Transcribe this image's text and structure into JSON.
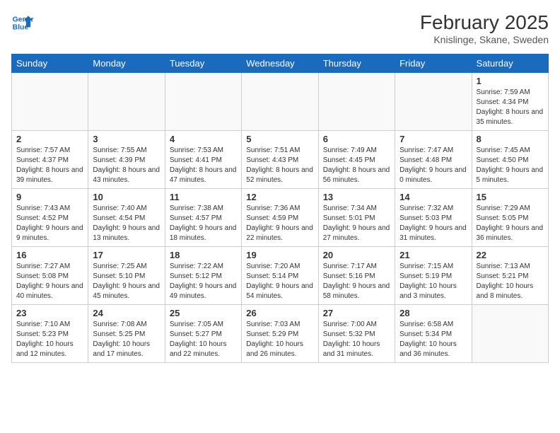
{
  "header": {
    "logo_line1": "General",
    "logo_line2": "Blue",
    "month_year": "February 2025",
    "location": "Knislinge, Skane, Sweden"
  },
  "days_of_week": [
    "Sunday",
    "Monday",
    "Tuesday",
    "Wednesday",
    "Thursday",
    "Friday",
    "Saturday"
  ],
  "weeks": [
    [
      {
        "day": "",
        "info": ""
      },
      {
        "day": "",
        "info": ""
      },
      {
        "day": "",
        "info": ""
      },
      {
        "day": "",
        "info": ""
      },
      {
        "day": "",
        "info": ""
      },
      {
        "day": "",
        "info": ""
      },
      {
        "day": "1",
        "info": "Sunrise: 7:59 AM\nSunset: 4:34 PM\nDaylight: 8 hours and 35 minutes."
      }
    ],
    [
      {
        "day": "2",
        "info": "Sunrise: 7:57 AM\nSunset: 4:37 PM\nDaylight: 8 hours and 39 minutes."
      },
      {
        "day": "3",
        "info": "Sunrise: 7:55 AM\nSunset: 4:39 PM\nDaylight: 8 hours and 43 minutes."
      },
      {
        "day": "4",
        "info": "Sunrise: 7:53 AM\nSunset: 4:41 PM\nDaylight: 8 hours and 47 minutes."
      },
      {
        "day": "5",
        "info": "Sunrise: 7:51 AM\nSunset: 4:43 PM\nDaylight: 8 hours and 52 minutes."
      },
      {
        "day": "6",
        "info": "Sunrise: 7:49 AM\nSunset: 4:45 PM\nDaylight: 8 hours and 56 minutes."
      },
      {
        "day": "7",
        "info": "Sunrise: 7:47 AM\nSunset: 4:48 PM\nDaylight: 9 hours and 0 minutes."
      },
      {
        "day": "8",
        "info": "Sunrise: 7:45 AM\nSunset: 4:50 PM\nDaylight: 9 hours and 5 minutes."
      }
    ],
    [
      {
        "day": "9",
        "info": "Sunrise: 7:43 AM\nSunset: 4:52 PM\nDaylight: 9 hours and 9 minutes."
      },
      {
        "day": "10",
        "info": "Sunrise: 7:40 AM\nSunset: 4:54 PM\nDaylight: 9 hours and 13 minutes."
      },
      {
        "day": "11",
        "info": "Sunrise: 7:38 AM\nSunset: 4:57 PM\nDaylight: 9 hours and 18 minutes."
      },
      {
        "day": "12",
        "info": "Sunrise: 7:36 AM\nSunset: 4:59 PM\nDaylight: 9 hours and 22 minutes."
      },
      {
        "day": "13",
        "info": "Sunrise: 7:34 AM\nSunset: 5:01 PM\nDaylight: 9 hours and 27 minutes."
      },
      {
        "day": "14",
        "info": "Sunrise: 7:32 AM\nSunset: 5:03 PM\nDaylight: 9 hours and 31 minutes."
      },
      {
        "day": "15",
        "info": "Sunrise: 7:29 AM\nSunset: 5:05 PM\nDaylight: 9 hours and 36 minutes."
      }
    ],
    [
      {
        "day": "16",
        "info": "Sunrise: 7:27 AM\nSunset: 5:08 PM\nDaylight: 9 hours and 40 minutes."
      },
      {
        "day": "17",
        "info": "Sunrise: 7:25 AM\nSunset: 5:10 PM\nDaylight: 9 hours and 45 minutes."
      },
      {
        "day": "18",
        "info": "Sunrise: 7:22 AM\nSunset: 5:12 PM\nDaylight: 9 hours and 49 minutes."
      },
      {
        "day": "19",
        "info": "Sunrise: 7:20 AM\nSunset: 5:14 PM\nDaylight: 9 hours and 54 minutes."
      },
      {
        "day": "20",
        "info": "Sunrise: 7:17 AM\nSunset: 5:16 PM\nDaylight: 9 hours and 58 minutes."
      },
      {
        "day": "21",
        "info": "Sunrise: 7:15 AM\nSunset: 5:19 PM\nDaylight: 10 hours and 3 minutes."
      },
      {
        "day": "22",
        "info": "Sunrise: 7:13 AM\nSunset: 5:21 PM\nDaylight: 10 hours and 8 minutes."
      }
    ],
    [
      {
        "day": "23",
        "info": "Sunrise: 7:10 AM\nSunset: 5:23 PM\nDaylight: 10 hours and 12 minutes."
      },
      {
        "day": "24",
        "info": "Sunrise: 7:08 AM\nSunset: 5:25 PM\nDaylight: 10 hours and 17 minutes."
      },
      {
        "day": "25",
        "info": "Sunrise: 7:05 AM\nSunset: 5:27 PM\nDaylight: 10 hours and 22 minutes."
      },
      {
        "day": "26",
        "info": "Sunrise: 7:03 AM\nSunset: 5:29 PM\nDaylight: 10 hours and 26 minutes."
      },
      {
        "day": "27",
        "info": "Sunrise: 7:00 AM\nSunset: 5:32 PM\nDaylight: 10 hours and 31 minutes."
      },
      {
        "day": "28",
        "info": "Sunrise: 6:58 AM\nSunset: 5:34 PM\nDaylight: 10 hours and 36 minutes."
      },
      {
        "day": "",
        "info": ""
      }
    ]
  ]
}
